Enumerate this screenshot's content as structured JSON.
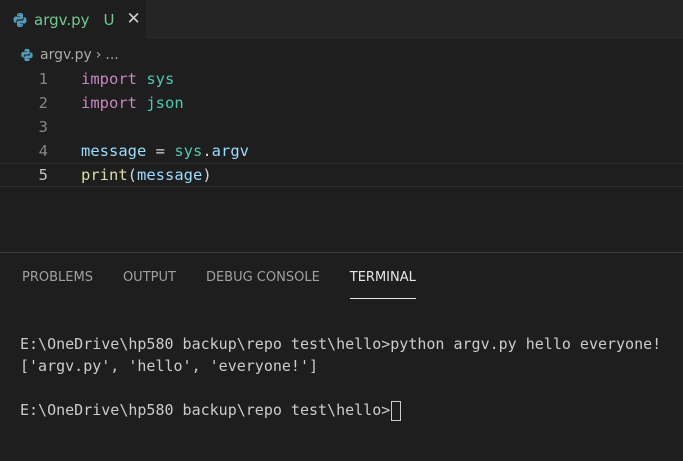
{
  "tab": {
    "filename": "argv.py",
    "status": "U",
    "close": "✕"
  },
  "breadcrumb": {
    "file": "argv.py",
    "separator": "›",
    "more": "..."
  },
  "editor": {
    "lines": [
      {
        "num": "1",
        "tokens": [
          {
            "t": "import",
            "c": "kw"
          },
          {
            "t": " ",
            "c": "op"
          },
          {
            "t": "sys",
            "c": "mod"
          }
        ]
      },
      {
        "num": "2",
        "tokens": [
          {
            "t": "import",
            "c": "kw"
          },
          {
            "t": " ",
            "c": "op"
          },
          {
            "t": "json",
            "c": "mod"
          }
        ]
      },
      {
        "num": "3",
        "tokens": []
      },
      {
        "num": "4",
        "tokens": [
          {
            "t": "message",
            "c": "var"
          },
          {
            "t": " = ",
            "c": "op"
          },
          {
            "t": "sys",
            "c": "mod"
          },
          {
            "t": ".",
            "c": "op"
          },
          {
            "t": "argv",
            "c": "var"
          }
        ]
      },
      {
        "num": "5",
        "tokens": [
          {
            "t": "print",
            "c": "fn"
          },
          {
            "t": "(",
            "c": "op"
          },
          {
            "t": "message",
            "c": "var"
          },
          {
            "t": ")",
            "c": "op"
          }
        ]
      }
    ],
    "current_line": 5
  },
  "panel": {
    "tabs": [
      "PROBLEMS",
      "OUTPUT",
      "DEBUG CONSOLE",
      "TERMINAL"
    ],
    "active_tab": "TERMINAL"
  },
  "terminal": {
    "lines": [
      "E:\\OneDrive\\hp580 backup\\repo test\\hello>python argv.py hello everyone!",
      "['argv.py', 'hello', 'everyone!']",
      "",
      "E:\\OneDrive\\hp580 backup\\repo test\\hello>"
    ]
  },
  "colors": {
    "background": "#1e1e1e",
    "tab_bar": "#252526",
    "untracked_green": "#73c991",
    "keyword": "#c586c0",
    "module": "#4ec9b0",
    "variable": "#9cdcfe",
    "function": "#dcdcaa"
  },
  "icons": {
    "file_icon": "python-icon",
    "close_icon": "close-icon"
  }
}
